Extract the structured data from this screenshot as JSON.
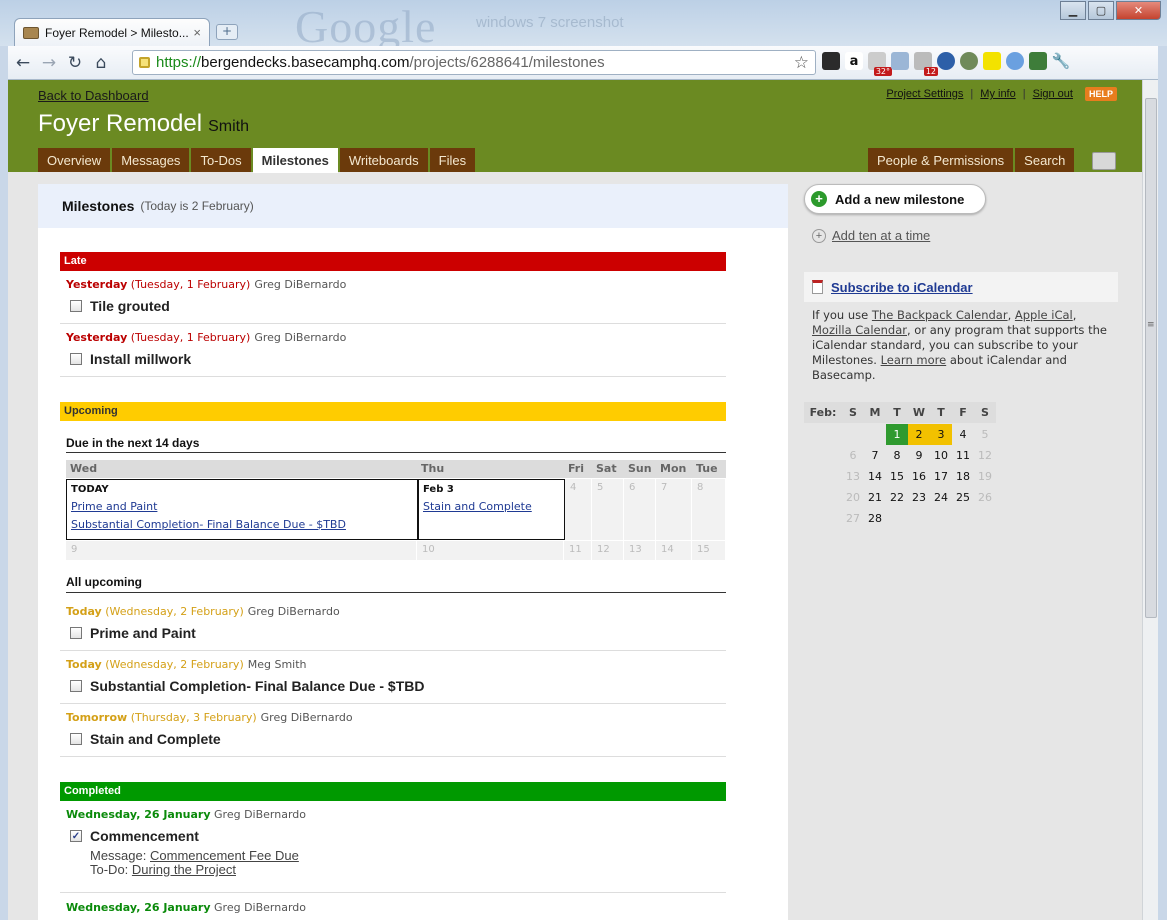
{
  "browser": {
    "tab_title": "Foyer Remodel > Milesto...",
    "tab_close": "×",
    "new_tab": "+",
    "bg_ghost": "Google",
    "bg_search": "windows 7 screenshot",
    "url_scheme": "https://",
    "url_host": "bergendecks.basecamphq.com",
    "url_path": "/projects/6288641/milestones",
    "ext_badges": {
      "cal": "32°",
      "mail": "12"
    }
  },
  "header": {
    "back_link": "Back to Dashboard",
    "project_name": "Foyer Remodel",
    "company": "Smith",
    "links": [
      "Project Settings",
      "My info",
      "Sign out"
    ],
    "help": "HELP",
    "tabs": [
      "Overview",
      "Messages",
      "To-Dos",
      "Milestones",
      "Writeboards",
      "Files"
    ],
    "right_tabs": [
      "People & Permissions",
      "Search"
    ]
  },
  "main": {
    "heading": "Milestones",
    "today_note": "(Today is 2 February)",
    "late": {
      "label": "Late",
      "items": [
        {
          "when": "Yesterday",
          "date": "(Tuesday, 1 February)",
          "person": "Greg DiBernardo",
          "title": "Tile grouted"
        },
        {
          "when": "Yesterday",
          "date": "(Tuesday, 1 February)",
          "person": "Greg DiBernardo",
          "title": "Install millwork"
        }
      ]
    },
    "upcoming": {
      "label": "Upcoming",
      "next14": "Due in the next 14 days",
      "cal_headers": [
        "Wed",
        "Thu",
        "Fri",
        "Sat",
        "Sun",
        "Mon",
        "Tue"
      ],
      "today_label": "TODAY",
      "today_links": [
        "Prime and Paint",
        "Substantial Completion- Final Balance Due - $TBD"
      ],
      "feb3_label": "Feb 3",
      "feb3_links": [
        "Stain and Complete"
      ],
      "week1_rest": [
        "4",
        "5",
        "6",
        "7",
        "8"
      ],
      "week2": [
        "9",
        "10",
        "11",
        "12",
        "13",
        "14",
        "15"
      ],
      "all": "All upcoming",
      "items": [
        {
          "when": "Today",
          "date": "(Wednesday, 2 February)",
          "person": "Greg DiBernardo",
          "title": "Prime and Paint"
        },
        {
          "when": "Today",
          "date": "(Wednesday, 2 February)",
          "person": "Meg Smith",
          "title": "Substantial Completion- Final Balance Due - $TBD"
        },
        {
          "when": "Tomorrow",
          "date": "(Thursday, 3 February)",
          "person": "Greg DiBernardo",
          "title": "Stain and Complete"
        }
      ]
    },
    "completed": {
      "label": "Completed",
      "items": [
        {
          "when": "Wednesday, 26 January",
          "person": "Greg DiBernardo",
          "title": "Commencement",
          "check": "✓",
          "msg_label": "Message:",
          "msg_link": "Commencement Fee Due",
          "todo_label": "To-Do:",
          "todo_link": "During the Project"
        },
        {
          "when": "Wednesday, 26 January",
          "person": "Greg DiBernardo"
        }
      ]
    }
  },
  "sidebar": {
    "add_milestone": "Add a new milestone",
    "add_plus": "+",
    "add_ten": "Add ten at a time",
    "subscribe": "Subscribe to iCalendar",
    "ical_t1": "If you use ",
    "ical_l1": "The Backpack Calendar",
    "ical_t2": ", ",
    "ical_l2": "Apple iCal",
    "ical_t3": ",",
    "ical_l3": "Mozilla Calendar",
    "ical_t4": ", or any program that supports the iCalendar standard, you can subscribe to your Milestones. ",
    "ical_l4": "Learn more",
    "ical_t5": " about iCalendar and Basecamp.",
    "cal_month": "Feb:",
    "cal_days": [
      "S",
      "M",
      "T",
      "W",
      "T",
      "F",
      "S"
    ],
    "cal_rows": [
      [
        "",
        "",
        "1",
        "2",
        "3",
        "4",
        "5"
      ],
      [
        "6",
        "7",
        "8",
        "9",
        "10",
        "11",
        "12"
      ],
      [
        "13",
        "14",
        "15",
        "16",
        "17",
        "18",
        "19"
      ],
      [
        "20",
        "21",
        "22",
        "23",
        "24",
        "25",
        "26"
      ],
      [
        "27",
        "28",
        "",
        "",
        "",
        "",
        ""
      ]
    ]
  },
  "colors": {
    "header": "#6b8a22",
    "tab": "#6b3a0b",
    "late": "#cc0000",
    "upcoming": "#ffcc00",
    "completed": "#009900",
    "today": "#2f9a2f"
  }
}
